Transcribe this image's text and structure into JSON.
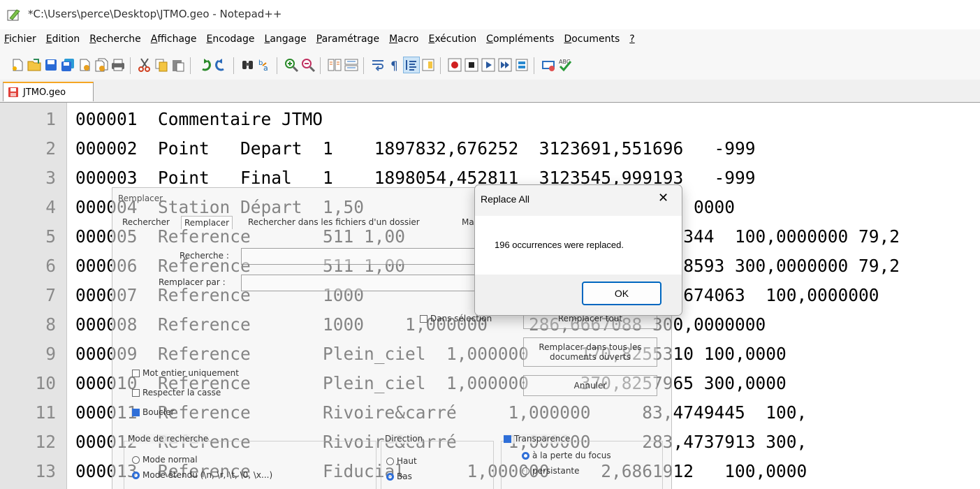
{
  "window": {
    "title": "*C:\\Users\\perce\\Desktop\\JTMO.geo - Notepad++"
  },
  "menu": [
    {
      "u": "F",
      "rest": "ichier"
    },
    {
      "u": "E",
      "rest": "dition"
    },
    {
      "u": "R",
      "rest": "echerche"
    },
    {
      "u": "A",
      "rest": "ffichage"
    },
    {
      "u": "E",
      "rest": "ncodage",
      "pre": ""
    },
    {
      "u": "L",
      "rest": "angage"
    },
    {
      "u": "P",
      "rest": "aramétrage"
    },
    {
      "u": "M",
      "rest": "acro"
    },
    {
      "u": "E",
      "rest": "xécution",
      "pre": ""
    },
    {
      "u": "C",
      "rest": "ompléments"
    },
    {
      "u": "D",
      "rest": "ocuments"
    },
    {
      "u": "?",
      "rest": ""
    }
  ],
  "tab": {
    "label": "JTMO.geo"
  },
  "lines": [
    {
      "n": "1",
      "text": "000001  Commentaire JTMO"
    },
    {
      "n": "2",
      "text": "000002  Point   Depart  1    1897832,676252  3123691,551696   -999"
    },
    {
      "n": "3",
      "text": "000003  Point   Final   1    1898054,452811  3123545,999193   -999"
    },
    {
      "n": "4",
      "text": "000004  Station Départ  1,50                                0000"
    },
    {
      "n": "5",
      "text": "000005  Reference       511 1,00                          5344  100,0000000 79,2"
    },
    {
      "n": "6",
      "text": "000006  Reference       511 1,00                          58593 300,0000000 79,2"
    },
    {
      "n": "7",
      "text": "000007  Reference       1000                              6674063  100,0000000"
    },
    {
      "n": "8",
      "text": "000008  Reference       1000    1,000000    286,6667088 300,0000000"
    },
    {
      "n": "9",
      "text": "000009  Reference       Plein_ciel  1,000000     170,8255310 100,0000"
    },
    {
      "n": "10",
      "text": "000010  Reference       Plein_ciel  1,000000     370,8257965 300,0000"
    },
    {
      "n": "11",
      "text": "000011  Reference       Rivoire&carré     1,000000     83,4749445  100,"
    },
    {
      "n": "12",
      "text": "000012  Reference       Rivoire&carré     1,000000     283,4737913 300,"
    },
    {
      "n": "13",
      "text": "000013  Reference       Fiducial      1,000000     2,6861912   100,0000"
    }
  ],
  "find_dialog": {
    "title": "Remplacer",
    "tabs": [
      "Rechercher",
      "Remplacer",
      "Rechercher dans les fichiers d'un dossier",
      "Ma"
    ],
    "find_label": "Recherche :",
    "replace_label": "Remplacer par :",
    "in_selection": "Dans sélection",
    "replace_all": "Remplacer tout",
    "replace_all_docs": "Remplacer dans tous les documents ouverts",
    "cancel": "Annuler",
    "whole_word": "Mot entier uniquement",
    "match_case": "Respecter la casse",
    "wrap": "Boucler",
    "search_mode": "Mode de recherche",
    "mode_normal": "Mode normal",
    "mode_extended": "Mode étendu (\\n, \\r, \\t, \\0, \\x...)",
    "direction": "Direction",
    "dir_up": "Haut",
    "dir_down": "Bas",
    "transparency": "Transparence",
    "on_focus_loss": "à la perte du focus",
    "persistent": "persistante"
  },
  "msgbox": {
    "title": "Replace All",
    "close": "✕",
    "message": "196 occurrences were replaced.",
    "ok": "OK"
  }
}
